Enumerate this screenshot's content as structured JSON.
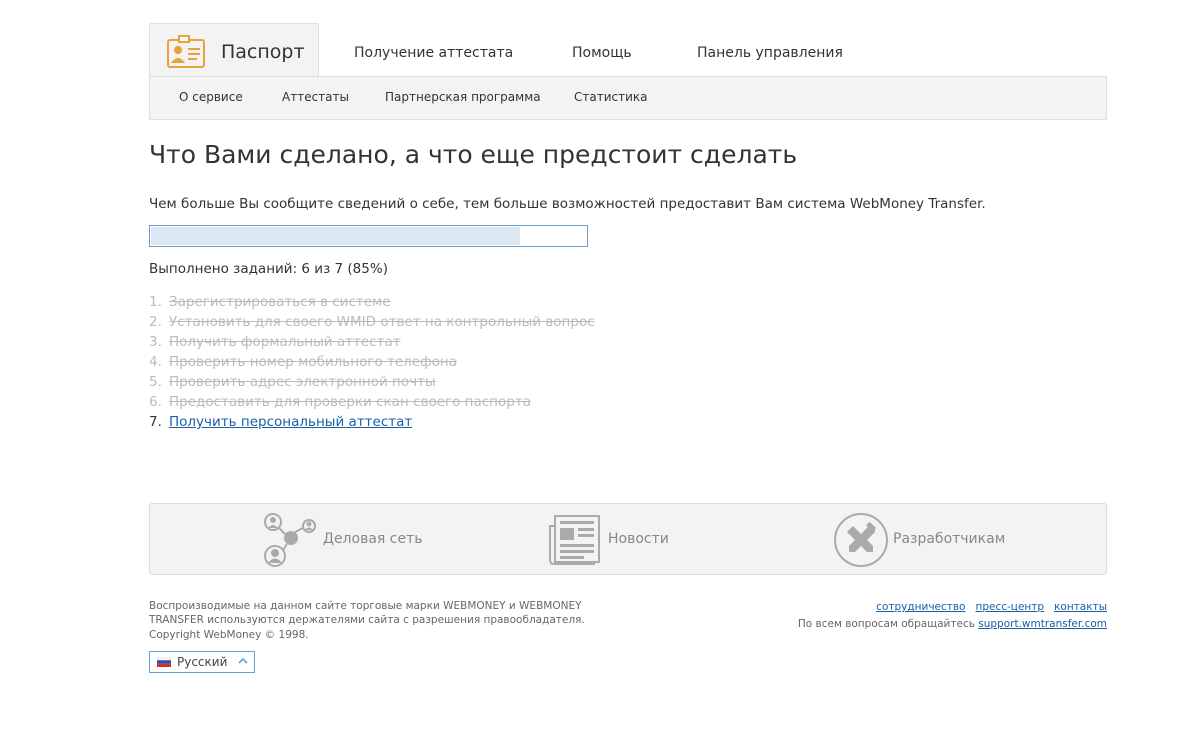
{
  "header": {
    "active_tab": "Паспорт",
    "tabs": [
      "Получение аттестата",
      "Помощь",
      "Панель управления"
    ],
    "logo_icon": "id-card-icon",
    "accent_color": "#e8a23a"
  },
  "subnav": {
    "items": [
      "О сервисе",
      "Аттестаты",
      "Партнерская программа",
      "Статистика"
    ]
  },
  "main": {
    "title": "Что Вами сделано, а что еще предстоит сделать",
    "lead": "Чем больше Вы сообщите сведений о себе, тем больше возможностей предоставит Вам система WebMoney Transfer.",
    "progress_percent": 85,
    "progress_text": "Выполнено заданий: 6 из 7 (85%)",
    "tasks": [
      {
        "num": "1.",
        "text": "Зарегистрироваться в системе",
        "done": true
      },
      {
        "num": "2.",
        "text": "Установить для своего WMID ответ на контрольный вопрос",
        "done": true
      },
      {
        "num": "3.",
        "text": "Получить формальный аттестат",
        "done": true
      },
      {
        "num": "4.",
        "text": "Проверить номер мобильного телефона",
        "done": true
      },
      {
        "num": "5.",
        "text": "Проверить адрес электронной почты",
        "done": true
      },
      {
        "num": "6.",
        "text": "Предоставить для проверки скан своего паспорта",
        "done": true
      },
      {
        "num": "7.",
        "text": "Получить персональный аттестат",
        "done": false
      }
    ]
  },
  "features": [
    {
      "label": "Деловая сеть",
      "icon": "business-network-icon"
    },
    {
      "label": "Новости",
      "icon": "newspaper-icon"
    },
    {
      "label": "Разработчикам",
      "icon": "tools-icon"
    }
  ],
  "footer": {
    "trademark": "Воспроизводимые на данном сайте торговые марки WEBMONEY и WEBMONEY TRANSFER используются держателями сайта с разрешения правообладателя.",
    "copyright": "Copyright WebMoney © 1998.",
    "links": [
      "сотрудничество",
      "пресс-центр",
      "контакты"
    ],
    "support_text": "По всем вопросам обращайтесь",
    "support_link": "support.wmtransfer.com",
    "language": "Русский"
  }
}
